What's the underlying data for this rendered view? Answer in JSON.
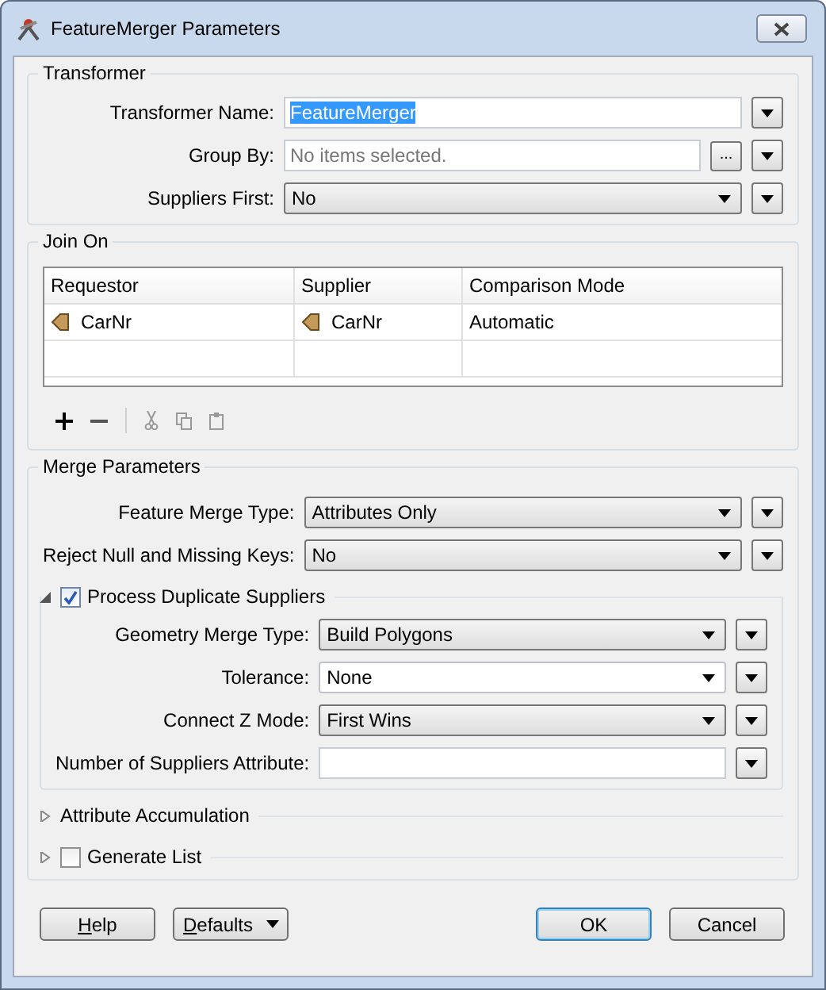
{
  "window": {
    "title": "FeatureMerger Parameters"
  },
  "transformer": {
    "title": "Transformer",
    "fields": [
      {
        "label": "Transformer Name:",
        "kind": "text",
        "value": "FeatureMerger",
        "highlighted": true
      },
      {
        "label": "Group By:",
        "kind": "picker",
        "placeholder": "No items selected.",
        "button": "..."
      },
      {
        "label": "Suppliers First:",
        "kind": "dropdown",
        "value": "No"
      }
    ]
  },
  "join_on": {
    "title": "Join On",
    "table": {
      "columns": [
        "Requestor",
        "Supplier",
        "Comparison Mode"
      ],
      "rows": [
        [
          {
            "kind": "attribute",
            "text": "CarNr"
          },
          {
            "kind": "attribute",
            "text": "CarNr"
          },
          {
            "kind": "plain",
            "text": "Automatic"
          }
        ]
      ]
    }
  },
  "merge_parameters": {
    "title": "Merge Parameters",
    "fields": [
      {
        "label": "Feature Merge Type:",
        "kind": "dropdown",
        "value": "Attributes Only"
      },
      {
        "label": "Reject Null and Missing Keys:",
        "kind": "dropdown",
        "value": "No"
      }
    ],
    "sections": [
      {
        "label": "Process Duplicate Suppliers",
        "kind": "checkbox",
        "expanded": true,
        "checked": true,
        "fields": [
          {
            "label": "Geometry Merge Type:",
            "kind": "dropdown",
            "value": "Build Polygons"
          },
          {
            "label": "Tolerance:",
            "kind": "combo",
            "value": "None"
          },
          {
            "label": "Connect Z Mode:",
            "kind": "dropdown",
            "value": "First Wins"
          },
          {
            "label": "Number of Suppliers Attribute:",
            "kind": "text"
          }
        ]
      },
      {
        "label": "Attribute Accumulation",
        "kind": "plain",
        "expanded": false
      },
      {
        "label": "Generate List",
        "kind": "checkbox",
        "expanded": false,
        "checked": false
      }
    ]
  },
  "buttons": [
    {
      "label": "Help",
      "kind": "plain",
      "default": false
    },
    {
      "label": "Defaults",
      "kind": "menu",
      "default": false
    },
    {
      "label": "OK",
      "kind": "plain",
      "default": true
    },
    {
      "label": "Cancel",
      "kind": "plain",
      "default": false
    }
  ]
}
